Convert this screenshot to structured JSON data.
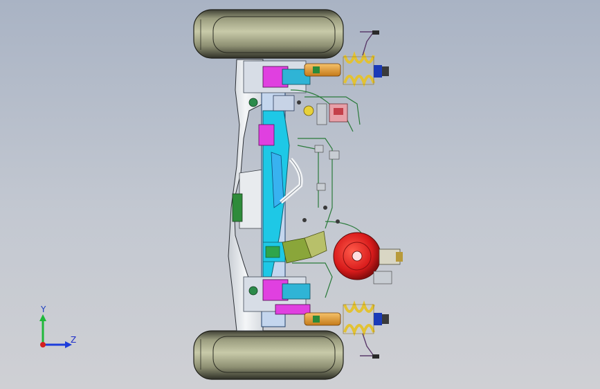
{
  "viewport": {
    "description_free": true
  },
  "triad": {
    "y_label": "Y",
    "z_label": "Z",
    "colors": {
      "y_axis": "#1fb83a",
      "z_axis": "#1d3ddb",
      "x_axis": "#d42020"
    }
  },
  "model_colors": {
    "tire": "#7a7c62",
    "brake_booster": "#d81b1b",
    "spring": "#e2c234",
    "shock": "#e8a53a",
    "frame": "#e9ecef",
    "drivetrain": "#1ec8e6",
    "steering": "#e040e0",
    "lines": "#2a8a3a"
  }
}
